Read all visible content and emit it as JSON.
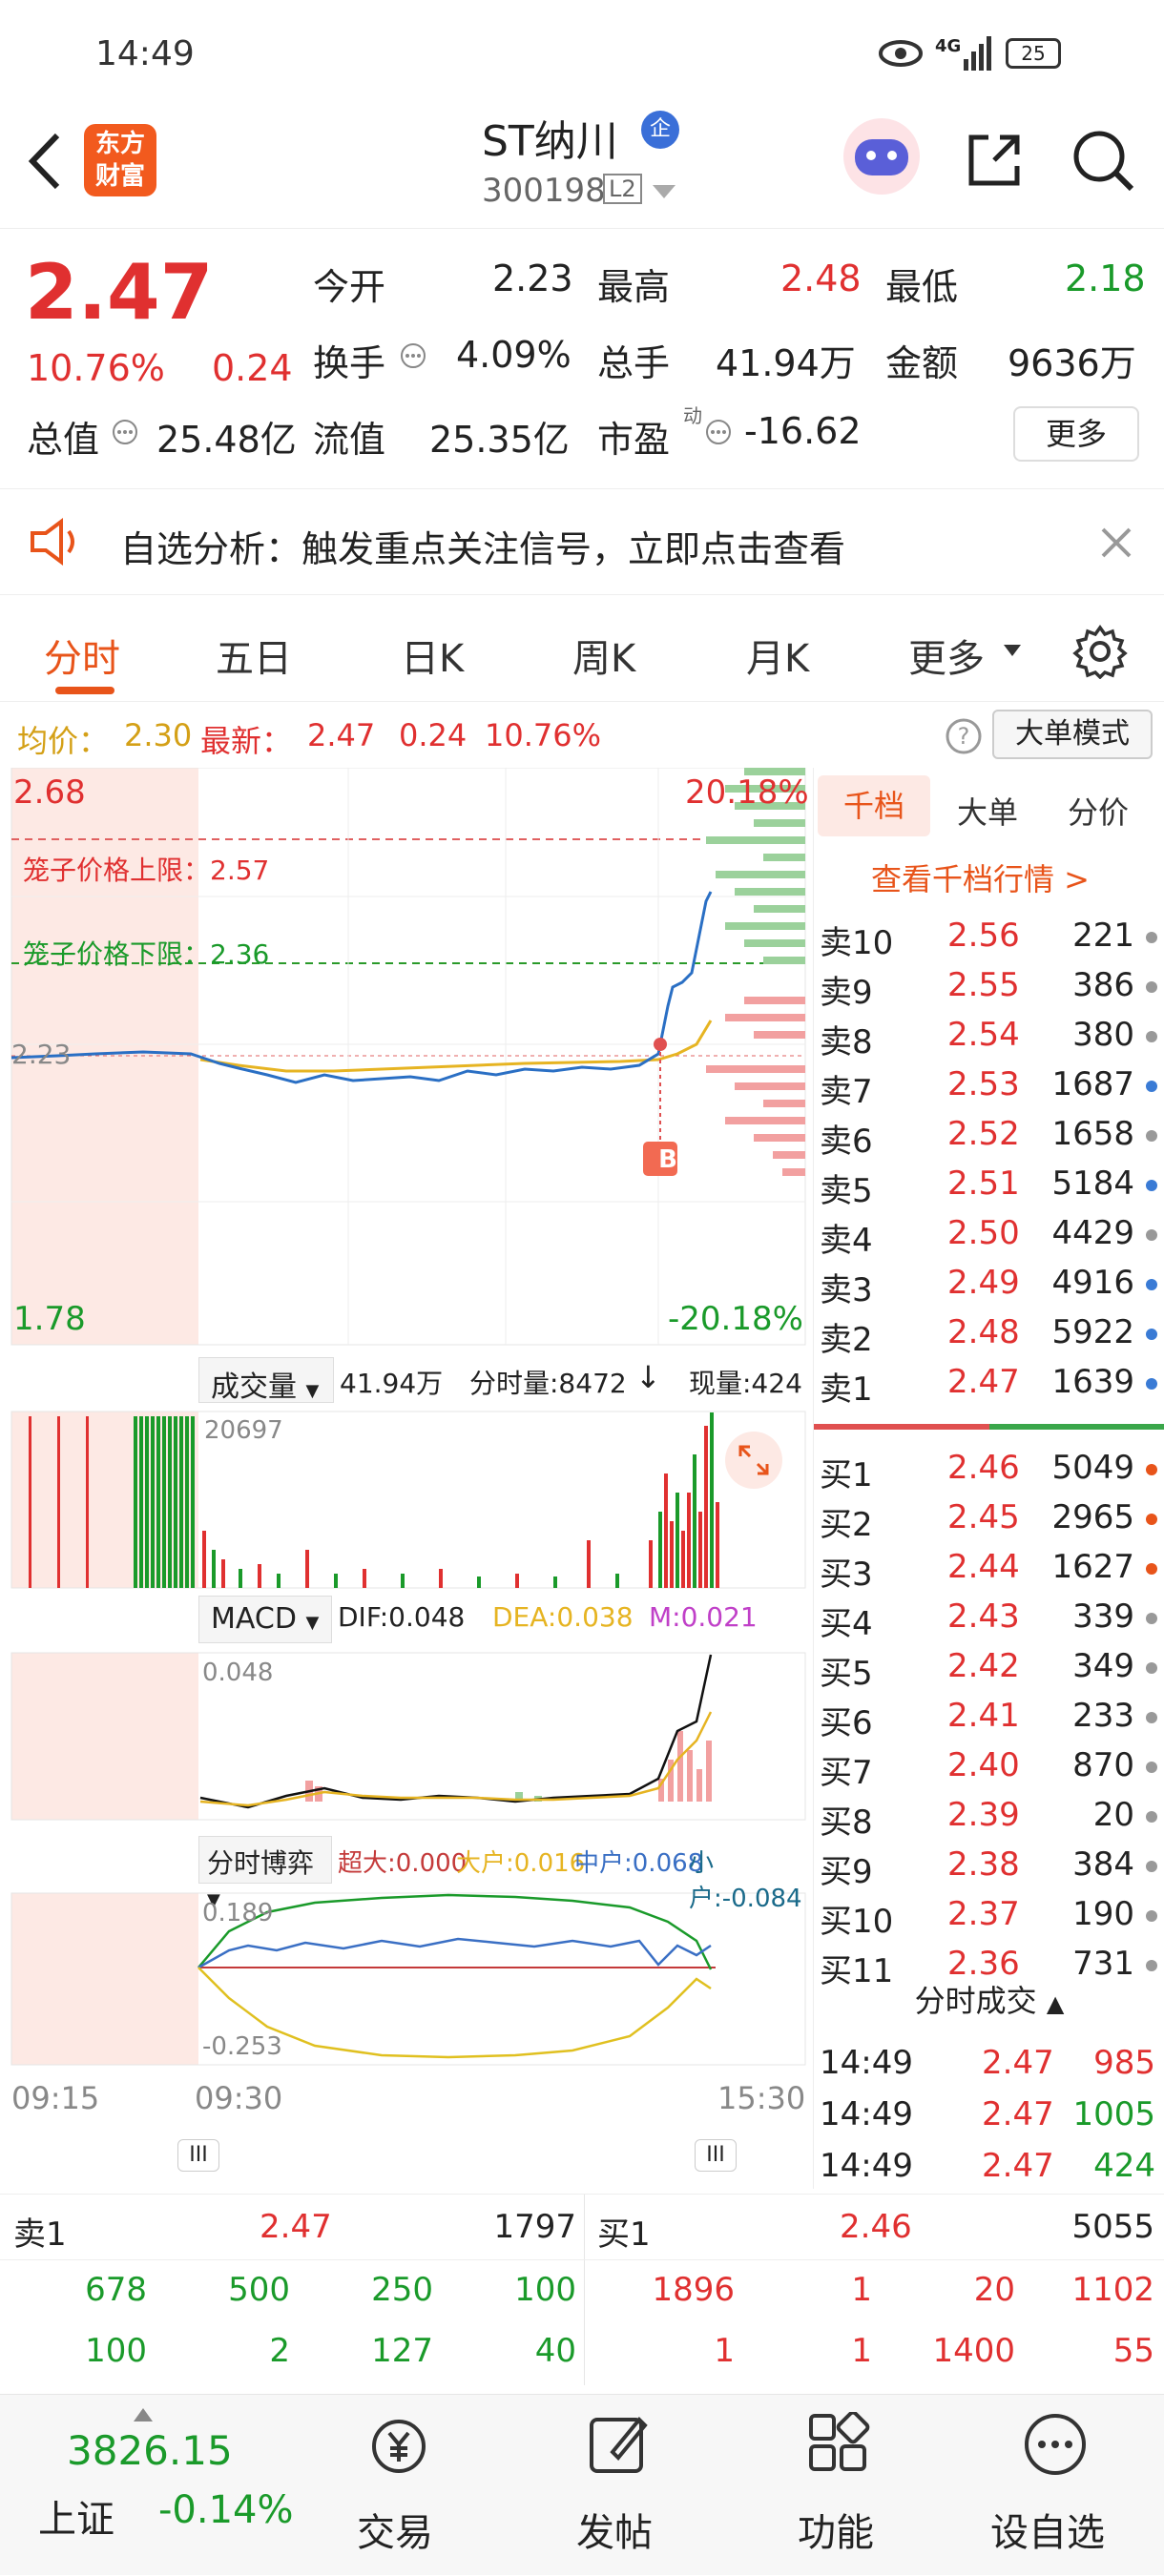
{
  "status_bar": {
    "time": "14:49",
    "network": "4G",
    "battery": "25"
  },
  "header": {
    "logo_line1": "东方",
    "logo_line2": "财富",
    "stock_name": "ST纳川",
    "badge": "企",
    "stock_code": "300198",
    "level": "L2"
  },
  "quote": {
    "price": "2.47",
    "change_pct": "10.76%",
    "change": "0.24",
    "open_label": "今开",
    "open": "2.23",
    "high_label": "最高",
    "high": "2.48",
    "low_label": "最低",
    "low": "2.18",
    "turnover_label": "换手",
    "turnover": "4.09%",
    "volume_label": "总手",
    "volume": "41.94万",
    "amount_label": "金额",
    "amount": "9636万",
    "mcap_label": "总值",
    "mcap": "25.48亿",
    "float_label": "流值",
    "float": "25.35亿",
    "pe_label": "市盈",
    "pe_sup": "动",
    "pe": "-16.62",
    "more": "更多"
  },
  "banner": {
    "text": "自选分析：触发重点关注信号，立即点击查看"
  },
  "tabs": [
    "分时",
    "五日",
    "日K",
    "周K",
    "月K",
    "更多"
  ],
  "info_line": {
    "avg_label": "均价：",
    "avg": "2.30",
    "latest_label": "最新：",
    "latest": "2.47",
    "chg": "0.24",
    "pct": "10.76%",
    "mode": "大单模式"
  },
  "chart": {
    "top_price": "2.68",
    "top_pct": "20.18%",
    "mid_price": "2.23",
    "bottom_price": "1.78",
    "bottom_pct": "-20.18%",
    "upper_limit": "笼子价格上限：2.57",
    "lower_limit": "笼子价格下限：2.36",
    "buy_marker": "B",
    "volume_label": "成交量",
    "volume_total": "41.94万",
    "minute_vol": "分时量:8472",
    "current_vol": "现量:424",
    "vol_max": "20697",
    "macd_label": "MACD",
    "dif": "DIF:0.048",
    "dea": "DEA:0.038",
    "m": "M:0.021",
    "macd_max": "0.048",
    "game_label": "分时博弈",
    "super": "超大:0.000",
    "large": "大户:0.016",
    "mid": "中户:0.068",
    "small": "小户:-0.084",
    "game_max": "0.189",
    "game_min": "-0.253",
    "time_start": "09:15",
    "time_open": "09:30",
    "time_end": "15:30"
  },
  "side": {
    "tabs": [
      "千档",
      "大单",
      "分价"
    ],
    "link": "查看千档行情 >",
    "asks": [
      {
        "label": "卖10",
        "price": "2.56",
        "vol": "221",
        "c": "#999"
      },
      {
        "label": "卖9",
        "price": "2.55",
        "vol": "386",
        "c": "#999"
      },
      {
        "label": "卖8",
        "price": "2.54",
        "vol": "380",
        "c": "#999"
      },
      {
        "label": "卖7",
        "price": "2.53",
        "vol": "1687",
        "c": "#3a7bd5"
      },
      {
        "label": "卖6",
        "price": "2.52",
        "vol": "1658",
        "c": "#999"
      },
      {
        "label": "卖5",
        "price": "2.51",
        "vol": "5184",
        "c": "#3a7bd5"
      },
      {
        "label": "卖4",
        "price": "2.50",
        "vol": "4429",
        "c": "#999"
      },
      {
        "label": "卖3",
        "price": "2.49",
        "vol": "4916",
        "c": "#3a7bd5"
      },
      {
        "label": "卖2",
        "price": "2.48",
        "vol": "5922",
        "c": "#3a7bd5"
      },
      {
        "label": "卖1",
        "price": "2.47",
        "vol": "1639",
        "c": "#3a7bd5"
      }
    ],
    "bids": [
      {
        "label": "买1",
        "price": "2.46",
        "vol": "5049",
        "c": "#e8541a"
      },
      {
        "label": "买2",
        "price": "2.45",
        "vol": "2965",
        "c": "#e8541a"
      },
      {
        "label": "买3",
        "price": "2.44",
        "vol": "1627",
        "c": "#e8541a"
      },
      {
        "label": "买4",
        "price": "2.43",
        "vol": "339",
        "c": "#999"
      },
      {
        "label": "买5",
        "price": "2.42",
        "vol": "349",
        "c": "#999"
      },
      {
        "label": "买6",
        "price": "2.41",
        "vol": "233",
        "c": "#999"
      },
      {
        "label": "买7",
        "price": "2.40",
        "vol": "870",
        "c": "#999"
      },
      {
        "label": "买8",
        "price": "2.39",
        "vol": "20",
        "c": "#999"
      },
      {
        "label": "买9",
        "price": "2.38",
        "vol": "384",
        "c": "#999"
      },
      {
        "label": "买10",
        "price": "2.37",
        "vol": "190",
        "c": "#999"
      },
      {
        "label": "买11",
        "price": "2.36",
        "vol": "731",
        "c": "#999"
      }
    ],
    "trades_title": "分时成交",
    "trades": [
      {
        "t": "14:49",
        "p": "2.47",
        "v": "985",
        "up": true
      },
      {
        "t": "14:49",
        "p": "2.47",
        "v": "1005",
        "up": false
      },
      {
        "t": "14:49",
        "p": "2.47",
        "v": "424",
        "up": false
      }
    ]
  },
  "book": {
    "sell_label": "卖1",
    "sell_price": "2.47",
    "sell_vol": "1797",
    "buy_label": "买1",
    "buy_price": "2.46",
    "buy_vol": "5055",
    "sell_q1": [
      "678",
      "500",
      "250",
      "100"
    ],
    "sell_q2": [
      "100",
      "2",
      "127",
      "40"
    ],
    "buy_q1": [
      "1896",
      "1",
      "20",
      "1102"
    ],
    "buy_q2": [
      "1",
      "1",
      "1400",
      "55"
    ]
  },
  "footer": {
    "index_value": "3826.15",
    "index_name": "上证",
    "index_pct": "-0.14%",
    "items": [
      "交易",
      "发帖",
      "功能",
      "设自选"
    ]
  }
}
